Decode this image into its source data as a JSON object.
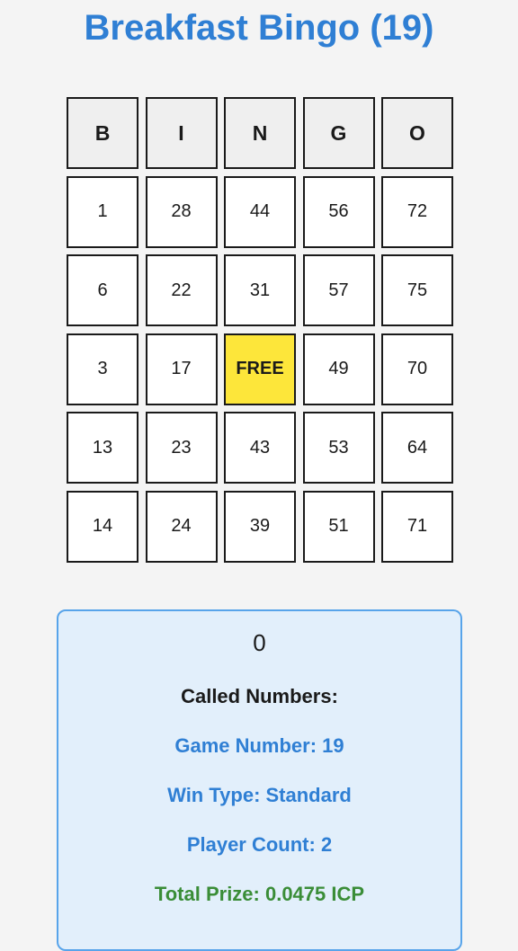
{
  "page": {
    "title": "Breakfast Bingo (19)"
  },
  "card": {
    "headers": [
      "B",
      "I",
      "N",
      "G",
      "O"
    ],
    "rows": [
      [
        "1",
        "28",
        "44",
        "56",
        "72"
      ],
      [
        "6",
        "22",
        "31",
        "57",
        "75"
      ],
      [
        "3",
        "17",
        "FREE",
        "49",
        "70"
      ],
      [
        "13",
        "23",
        "43",
        "53",
        "64"
      ],
      [
        "14",
        "24",
        "39",
        "51",
        "71"
      ]
    ],
    "free_cell_color": "#fde63a"
  },
  "info": {
    "current_ball": "0",
    "called_label": "Called Numbers:",
    "game_number": "Game Number: 19",
    "win_type": "Win Type: Standard",
    "player_count": "Player Count: 2",
    "total_prize": "Total Prize: 0.0475 ICP"
  },
  "colors": {
    "accent": "#2f7fd4",
    "prize": "#3a8d37",
    "panel_bg": "#e2effb",
    "panel_border": "#58a4ea"
  }
}
